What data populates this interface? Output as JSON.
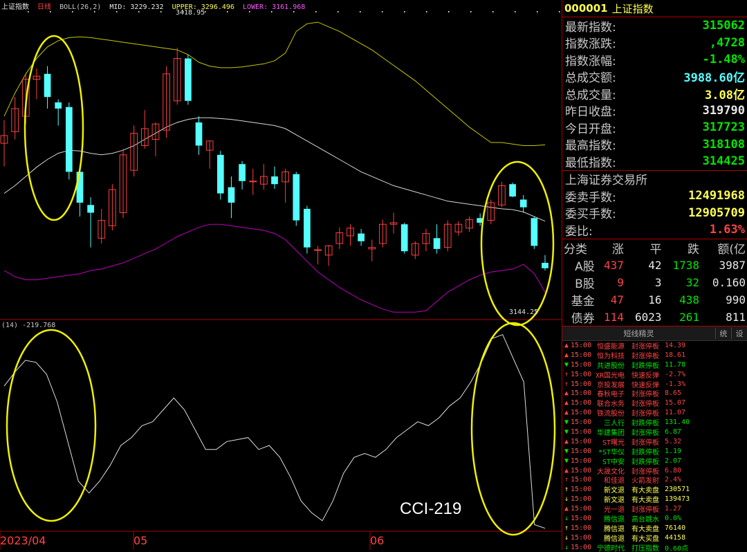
{
  "header": {
    "name": "上证指数",
    "period": "日线",
    "indicator": "BOLL(26,2)",
    "mid": "MID: 3229.232",
    "upper": "UPPER: 3296.496",
    "lower": "LOWER: 3161.968",
    "high_label": "3418.95",
    "low_label": "3144.25"
  },
  "cci_header": "(14) -219.768",
  "cci_annotation": "CCI-219",
  "dates": [
    "2023/04",
    "05",
    "06"
  ],
  "quote": {
    "code": "000001",
    "name": "上证指数",
    "rows": [
      {
        "label": "最新指数:",
        "value": "315062",
        "color": "#00e600"
      },
      {
        "label": "指数涨跌:",
        "value": ",4728",
        "color": "#00e600"
      },
      {
        "label": "指数涨幅:",
        "value": "-1.48%",
        "color": "#00e600"
      },
      {
        "label": "总成交额:",
        "value": "3988.60亿",
        "color": "#55ffff"
      },
      {
        "label": "总成交量:",
        "value": "3.08亿",
        "color": "#ffff55"
      },
      {
        "label": "昨日收盘:",
        "value": "319790",
        "color": "#e8e8e8"
      },
      {
        "label": "今日开盘:",
        "value": "317723",
        "color": "#00e600"
      },
      {
        "label": "最高指数:",
        "value": "318108",
        "color": "#00e600"
      },
      {
        "label": "最低指数:",
        "value": "314425",
        "color": "#00e600"
      }
    ],
    "exchange": "上海证券交易所",
    "rows2": [
      {
        "label": "委卖手数:",
        "value": "12491968",
        "color": "#ffff55"
      },
      {
        "label": "委买手数:",
        "value": "12905709",
        "color": "#ffff55"
      },
      {
        "label": "委比:",
        "value": "1.63%",
        "color": "#ff4444"
      }
    ]
  },
  "breadth": {
    "headers": [
      "分类",
      "涨",
      "平",
      "跌",
      "额(亿"
    ],
    "rows": [
      {
        "name": "A股",
        "up": "437",
        "flat": "42",
        "down": "1738",
        "amt": "3987"
      },
      {
        "name": "B股",
        "up": "9",
        "flat": "3",
        "down": "32",
        "amt": "0.160"
      },
      {
        "name": "基金",
        "up": "47",
        "flat": "16",
        "down": "438",
        "amt": "990"
      },
      {
        "name": "债券",
        "up": "114",
        "flat": "6023",
        "down": "261",
        "amt": "811"
      }
    ]
  },
  "sprite": {
    "title": "短线精灵",
    "btn1": "统",
    "btn2": "设",
    "items": [
      {
        "arrow": "▲",
        "time": "15:00",
        "name": "恒盛能源",
        "event": "封涨停板",
        "value": "14.39",
        "color": "#ff4444"
      },
      {
        "arrow": "▲",
        "time": "15:00",
        "name": "恒为科技",
        "event": "封涨停板",
        "value": "18.61",
        "color": "#ff4444"
      },
      {
        "arrow": "▼",
        "time": "15:00",
        "name": "共进股份",
        "event": "封跌停板",
        "value": "11.78",
        "color": "#00e600"
      },
      {
        "arrow": "↑",
        "time": "15:00",
        "name": "XR国光电",
        "event": "快速反弹",
        "value": "-2.7%",
        "color": "#ff4444"
      },
      {
        "arrow": "↑",
        "time": "15:00",
        "name": "京投发展",
        "event": "快速反弹",
        "value": "-1.3%",
        "color": "#ff4444"
      },
      {
        "arrow": "▲",
        "time": "15:00",
        "name": "春秋电子",
        "event": "封涨停板",
        "value": "8.65",
        "color": "#ff4444"
      },
      {
        "arrow": "▲",
        "time": "15:00",
        "name": "联合水务",
        "event": "封涨停板",
        "value": "15.07",
        "color": "#ff4444"
      },
      {
        "arrow": "▲",
        "time": "15:00",
        "name": "铁流股份",
        "event": "封涨停板",
        "value": "11.07",
        "color": "#ff4444"
      },
      {
        "arrow": "▼",
        "time": "15:00",
        "name": "三人行",
        "event": "封跌停板",
        "value": "131.40",
        "color": "#00e600"
      },
      {
        "arrow": "▼",
        "time": "15:00",
        "name": "华建集团",
        "event": "封涨停板",
        "value": "6.87",
        "color": "#00e600"
      },
      {
        "arrow": "▲",
        "time": "15:00",
        "name": "ST曙光",
        "event": "封涨停板",
        "value": "5.32",
        "color": "#ff4444"
      },
      {
        "arrow": "▼",
        "time": "15:00",
        "name": "*ST华仪",
        "event": "封跌停板",
        "value": "1.19",
        "color": "#00e600"
      },
      {
        "arrow": "▼",
        "time": "15:00",
        "name": "ST中安",
        "event": "封跌停板",
        "value": "2.07",
        "color": "#00e600"
      },
      {
        "arrow": "▲",
        "time": "15:00",
        "name": "大晟文化",
        "event": "封涨停板",
        "value": "6.80",
        "color": "#ff4444"
      },
      {
        "arrow": "↑",
        "time": "15:00",
        "name": "和佳退",
        "event": "火箭发射",
        "value": "2.4%",
        "color": "#ff4444"
      },
      {
        "arrow": "↑",
        "time": "15:00",
        "name": "新文退",
        "event": "有大卖盘",
        "value": "230571",
        "color": "#ffff55"
      },
      {
        "arrow": "↓",
        "time": "15:00",
        "name": "新文退",
        "event": "有大卖盘",
        "value": "139473",
        "color": "#ffff55"
      },
      {
        "arrow": "▲",
        "time": "15:00",
        "name": "光一退",
        "event": "封涨停板",
        "value": "1.27",
        "color": "#ff4444"
      },
      {
        "arrow": "↓",
        "time": "15:00",
        "name": "腾信退",
        "event": "高台跳水",
        "value": "0.0%",
        "color": "#00e600"
      },
      {
        "arrow": "↑",
        "time": "15:00",
        "name": "腾信退",
        "event": "有大卖盘",
        "value": "76140",
        "color": "#ffff55"
      },
      {
        "arrow": "↓",
        "time": "15:00",
        "name": "腾信退",
        "event": "有大买盘",
        "value": "44158",
        "color": "#ffff55"
      },
      {
        "arrow": "↓",
        "time": "15:00",
        "name": "宁德时代",
        "event": "打压指数",
        "value": "0.60点",
        "color": "#00e600"
      }
    ]
  },
  "chart_data": {
    "type": "candlestick",
    "candles": [
      {
        "o": 3295,
        "h": 3325,
        "l": 3265,
        "c": 3305
      },
      {
        "o": 3310,
        "h": 3355,
        "l": 3300,
        "c": 3340
      },
      {
        "o": 3330,
        "h": 3385,
        "l": 3320,
        "c": 3378
      },
      {
        "o": 3378,
        "h": 3392,
        "l": 3352,
        "c": 3382
      },
      {
        "o": 3385,
        "h": 3395,
        "l": 3340,
        "c": 3355
      },
      {
        "o": 3348,
        "h": 3352,
        "l": 3318,
        "c": 3340
      },
      {
        "o": 3342,
        "h": 3348,
        "l": 3248,
        "c": 3258
      },
      {
        "o": 3258,
        "h": 3262,
        "l": 3200,
        "c": 3218
      },
      {
        "o": 3215,
        "h": 3225,
        "l": 3160,
        "c": 3205
      },
      {
        "o": 3172,
        "h": 3210,
        "l": 3165,
        "c": 3195
      },
      {
        "o": 3188,
        "h": 3242,
        "l": 3182,
        "c": 3235
      },
      {
        "o": 3205,
        "h": 3288,
        "l": 3198,
        "c": 3280
      },
      {
        "o": 3260,
        "h": 3318,
        "l": 3252,
        "c": 3308
      },
      {
        "o": 3292,
        "h": 3338,
        "l": 3288,
        "c": 3314
      },
      {
        "o": 3300,
        "h": 3322,
        "l": 3278,
        "c": 3320
      },
      {
        "o": 3312,
        "h": 3395,
        "l": 3302,
        "c": 3385
      },
      {
        "o": 3350,
        "h": 3419,
        "l": 3345,
        "c": 3405
      },
      {
        "o": 3405,
        "h": 3410,
        "l": 3345,
        "c": 3350
      },
      {
        "o": 3322,
        "h": 3330,
        "l": 3280,
        "c": 3292
      },
      {
        "o": 3286,
        "h": 3298,
        "l": 3262,
        "c": 3298
      },
      {
        "o": 3280,
        "h": 3285,
        "l": 3222,
        "c": 3230
      },
      {
        "o": 3238,
        "h": 3252,
        "l": 3198,
        "c": 3218
      },
      {
        "o": 3268,
        "h": 3272,
        "l": 3235,
        "c": 3246
      },
      {
        "o": 3245,
        "h": 3262,
        "l": 3228,
        "c": 3246
      },
      {
        "o": 3242,
        "h": 3268,
        "l": 3235,
        "c": 3252
      },
      {
        "o": 3252,
        "h": 3265,
        "l": 3236,
        "c": 3242
      },
      {
        "o": 3245,
        "h": 3262,
        "l": 3218,
        "c": 3258
      },
      {
        "o": 3255,
        "h": 3258,
        "l": 3188,
        "c": 3195
      },
      {
        "o": 3210,
        "h": 3214,
        "l": 3152,
        "c": 3160
      },
      {
        "o": 3156,
        "h": 3162,
        "l": 3138,
        "c": 3157
      },
      {
        "o": 3150,
        "h": 3163,
        "l": 3136,
        "c": 3162
      },
      {
        "o": 3165,
        "h": 3186,
        "l": 3158,
        "c": 3179
      },
      {
        "o": 3175,
        "h": 3190,
        "l": 3162,
        "c": 3185
      },
      {
        "o": 3178,
        "h": 3184,
        "l": 3162,
        "c": 3168
      },
      {
        "o": 3158,
        "h": 3170,
        "l": 3142,
        "c": 3160
      },
      {
        "o": 3165,
        "h": 3196,
        "l": 3160,
        "c": 3190
      },
      {
        "o": 3190,
        "h": 3205,
        "l": 3178,
        "c": 3192
      },
      {
        "o": 3190,
        "h": 3192,
        "l": 3152,
        "c": 3155
      },
      {
        "o": 3150,
        "h": 3168,
        "l": 3145,
        "c": 3165
      },
      {
        "o": 3165,
        "h": 3184,
        "l": 3155,
        "c": 3178
      },
      {
        "o": 3172,
        "h": 3190,
        "l": 3152,
        "c": 3158
      },
      {
        "o": 3160,
        "h": 3195,
        "l": 3155,
        "c": 3190
      },
      {
        "o": 3180,
        "h": 3194,
        "l": 3175,
        "c": 3190
      },
      {
        "o": 3185,
        "h": 3200,
        "l": 3180,
        "c": 3196
      },
      {
        "o": 3198,
        "h": 3204,
        "l": 3188,
        "c": 3192
      },
      {
        "o": 3195,
        "h": 3222,
        "l": 3190,
        "c": 3218
      },
      {
        "o": 3215,
        "h": 3245,
        "l": 3212,
        "c": 3240
      },
      {
        "o": 3242,
        "h": 3244,
        "l": 3225,
        "c": 3226
      },
      {
        "o": 3222,
        "h": 3228,
        "l": 3205,
        "c": 3212
      },
      {
        "o": 3198,
        "h": 3200,
        "l": 3158,
        "c": 3162
      },
      {
        "o": 3140,
        "h": 3150,
        "l": 3130,
        "c": 3133
      }
    ],
    "boll_upper": [
      3330,
      3360,
      3385,
      3405,
      3420,
      3428,
      3432,
      3433,
      3432,
      3430,
      3428,
      3426,
      3424,
      3422,
      3420,
      3418,
      3416,
      3410,
      3400,
      3395,
      3393,
      3393,
      3394,
      3396,
      3398,
      3402,
      3412,
      3440,
      3450,
      3452,
      3446,
      3440,
      3432,
      3424,
      3416,
      3406,
      3396,
      3386,
      3376,
      3364,
      3352,
      3340,
      3328,
      3316,
      3306,
      3296,
      3296,
      3294,
      3292,
      3292,
      3293
    ],
    "boll_mid": [
      3230,
      3240,
      3252,
      3264,
      3274,
      3282,
      3286,
      3285,
      3282,
      3280,
      3282,
      3286,
      3292,
      3300,
      3308,
      3316,
      3322,
      3326,
      3328,
      3328,
      3327,
      3326,
      3324,
      3322,
      3320,
      3318,
      3314,
      3306,
      3298,
      3290,
      3282,
      3274,
      3266,
      3258,
      3252,
      3246,
      3240,
      3236,
      3232,
      3228,
      3224,
      3220,
      3218,
      3216,
      3214,
      3212,
      3210,
      3209,
      3206,
      3200,
      3194
    ],
    "boll_lower": [
      3130,
      3122,
      3118,
      3118,
      3120,
      3122,
      3124,
      3126,
      3130,
      3132,
      3136,
      3140,
      3146,
      3152,
      3158,
      3166,
      3174,
      3180,
      3186,
      3190,
      3190,
      3188,
      3186,
      3184,
      3182,
      3178,
      3170,
      3156,
      3142,
      3128,
      3118,
      3108,
      3100,
      3092,
      3086,
      3080,
      3076,
      3076,
      3076,
      3078,
      3090,
      3102,
      3110,
      3118,
      3124,
      3128,
      3130,
      3132,
      3138,
      3126,
      3102
    ],
    "cci": [
      140,
      175,
      205,
      200,
      170,
      100,
      0,
      -100,
      -130,
      -100,
      -60,
      -10,
      10,
      40,
      50,
      80,
      110,
      80,
      30,
      -20,
      -20,
      0,
      5,
      10,
      -20,
      -10,
      -40,
      -90,
      -150,
      -180,
      -200,
      -150,
      -80,
      -40,
      -30,
      -40,
      -20,
      10,
      30,
      50,
      40,
      60,
      90,
      110,
      150,
      200,
      260,
      270,
      210,
      150,
      -210,
      -219
    ],
    "cci_ylim": [
      -230,
      280
    ],
    "price_ylim": [
      3070,
      3470
    ]
  }
}
